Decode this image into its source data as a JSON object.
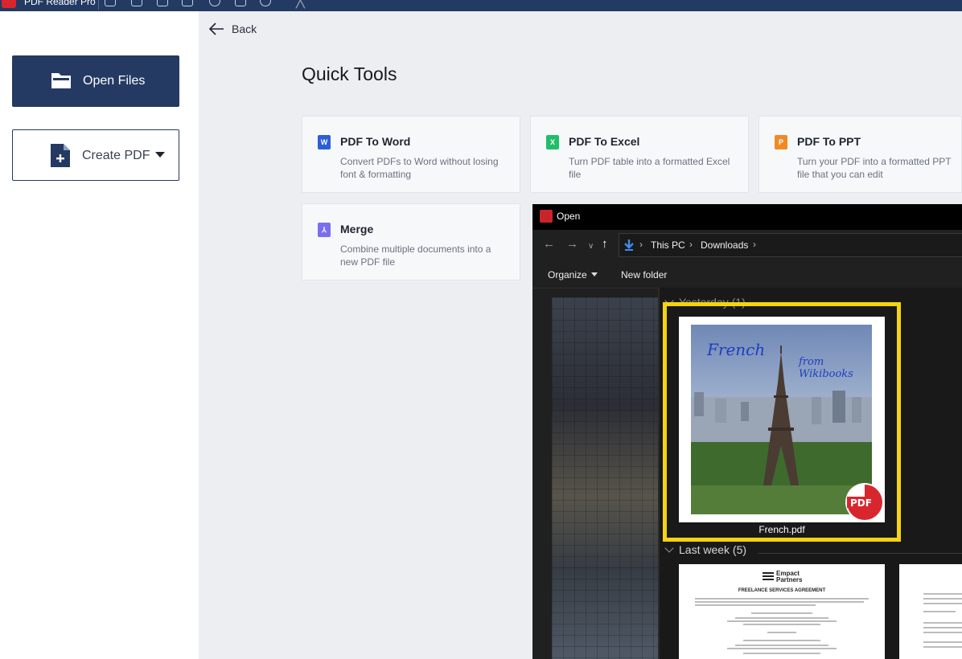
{
  "app": {
    "title": "PDF Reader Pro"
  },
  "sidebar": {
    "open_files_label": "Open Files",
    "create_pdf_label": "Create PDF"
  },
  "header": {
    "back_label": "Back"
  },
  "quick_tools": {
    "title": "Quick Tools",
    "cards": [
      {
        "title": "PDF To Word",
        "desc": "Convert PDFs to Word without losing font & formatting",
        "icon": "word-icon",
        "icon_letter": "W",
        "color": "#2b5fd9"
      },
      {
        "title": "PDF To Excel",
        "desc": "Turn PDF table into a formatted Excel file",
        "icon": "excel-icon",
        "icon_letter": "X",
        "color": "#1fbf6a"
      },
      {
        "title": "PDF To PPT",
        "desc": "Turn your PDF into a formatted PPT file that you can edit",
        "icon": "ppt-icon",
        "icon_letter": "P",
        "color": "#f08a24"
      },
      {
        "title": "Merge",
        "desc": "Combine multiple documents into a new PDF file",
        "icon": "merge-icon",
        "icon_letter": "⅄",
        "color": "#7a6ef0"
      }
    ]
  },
  "open_dialog": {
    "title": "Open",
    "breadcrumb": [
      "This PC",
      "Downloads"
    ],
    "toolbar": {
      "organize_label": "Organize",
      "new_folder_label": "New folder"
    },
    "groups": [
      {
        "label": "Yesterday (1)",
        "files": [
          {
            "name": "French.pdf",
            "cover_title": "French",
            "cover_subtitle_1": "from",
            "cover_subtitle_2": "Wikibooks",
            "badge": "PDF"
          }
        ]
      },
      {
        "label": "Last week (5)"
      }
    ],
    "doc_preview": {
      "logo_text_1": "Empact",
      "logo_text_2": "Partners",
      "heading": "FREELANCE SERVICES AGREEMENT"
    }
  }
}
